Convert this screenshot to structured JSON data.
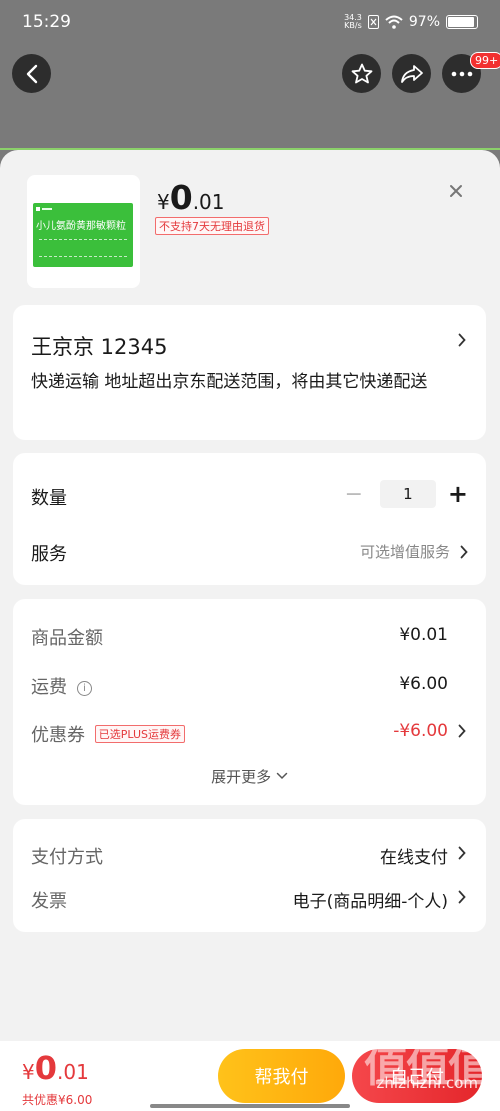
{
  "status_bar": {
    "time": "15:29",
    "net_speed_value": "34.3",
    "net_speed_unit": "KB/s",
    "battery": "97%"
  },
  "header": {
    "back_icon": "arrow-left",
    "favorite_icon": "star",
    "share_icon": "share-arrow",
    "more_icon": "ellipsis",
    "message_badge": "99+"
  },
  "product": {
    "image_text": "小儿氨酚黄那敏颗粒",
    "price_currency": "¥",
    "price_int": "0",
    "price_dec": ".01",
    "notice": "不支持7天无理由退货"
  },
  "address": {
    "name_phone": "王京京  12345",
    "delivery_note": "快递运输 地址超出京东配送范围，将由其它快递配送"
  },
  "quantity": {
    "label": "数量",
    "minus": "−",
    "value": "1",
    "plus": "+"
  },
  "service": {
    "label": "服务",
    "value": "可选增值服务"
  },
  "summary": {
    "goods_label": "商品金额",
    "goods_value": "¥0.01",
    "shipping_label": "运费",
    "shipping_value": "¥6.00",
    "coupon_label": "优惠券",
    "coupon_tag": "已选PLUS运费券",
    "coupon_value": "-¥6.00",
    "expand": "展开更多"
  },
  "payment": {
    "method_label": "支付方式",
    "method_value": "在线支付",
    "invoice_label": "发票",
    "invoice_value": "电子(商品明细-个人)"
  },
  "footer": {
    "currency": "¥",
    "int": "0",
    "dec": ".01",
    "saved": "共优惠¥6.00",
    "help_pay": "帮我付",
    "pay": "自己付"
  },
  "watermark": {
    "mark": "值值值",
    "site": "zhizhizhi.com"
  },
  "colors": {
    "accent_red": "#e4393c",
    "help_yellow": "#ffb312",
    "sheet_bg": "#f2f2f2"
  }
}
